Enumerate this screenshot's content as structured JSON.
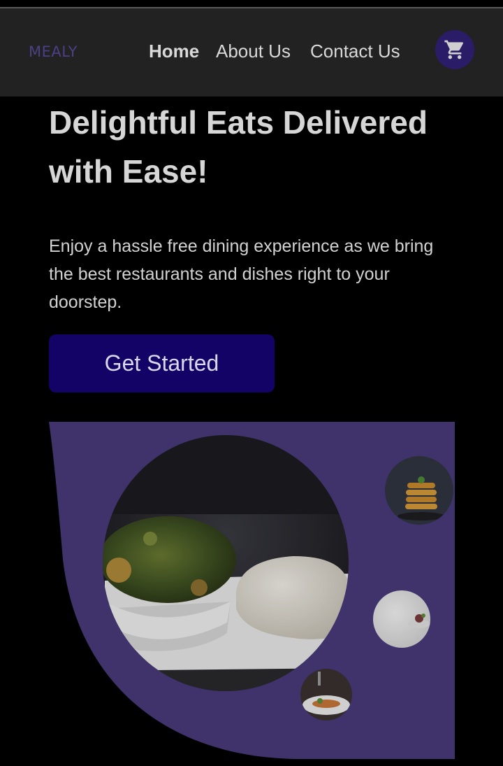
{
  "header": {
    "logo": "MEALY",
    "nav": {
      "home": "Home",
      "about": "About Us",
      "contact": "Contact Us"
    },
    "cart_icon": "shopping-cart-icon"
  },
  "hero": {
    "headline": "Delightful Eats Delivered with Ease!",
    "description": "Enjoy a hassle free dining experience as we bring the best restaurants and dishes right to your doorstep.",
    "cta_label": "Get Started"
  },
  "colors": {
    "background": "#000000",
    "navbar": "#222222",
    "accent_purple": "#493a79",
    "cta_background": "#130366",
    "cart_background": "#2b1c67",
    "logo": "#4d3f86"
  },
  "images": {
    "main_dish": "leafy-vegetable-soup-with-pounded-yam",
    "thumb_1": "pancake-stack",
    "thumb_2": "plated-dessert",
    "thumb_3": "grilled-fish-plate"
  }
}
